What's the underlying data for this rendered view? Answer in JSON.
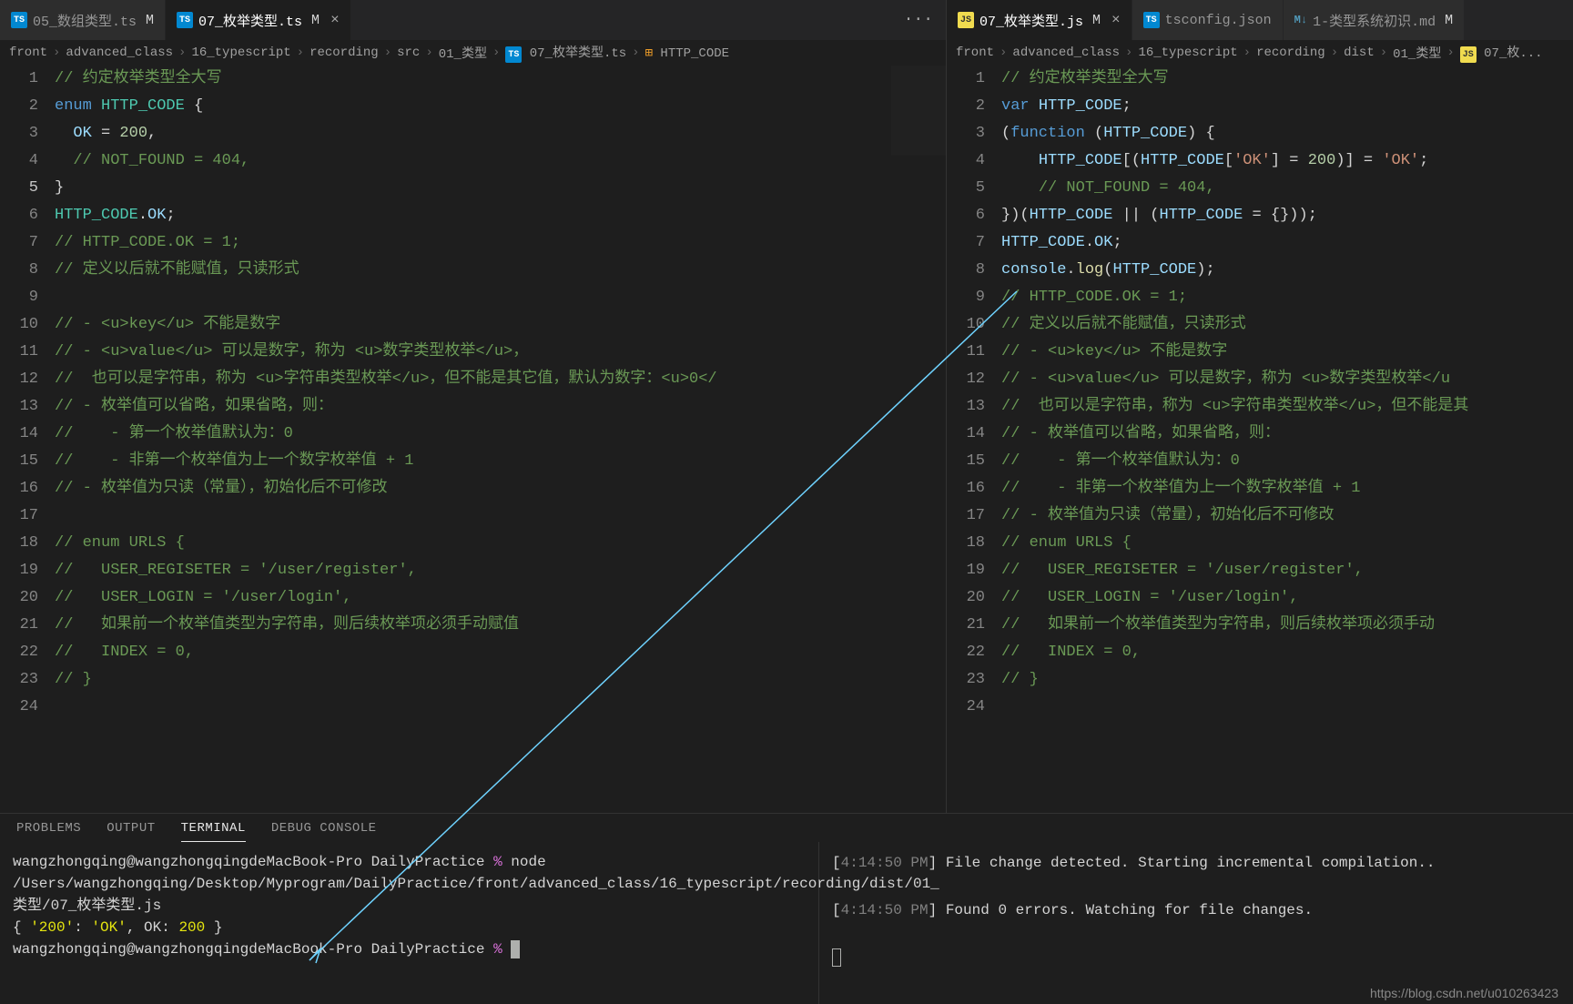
{
  "left": {
    "tabs": [
      {
        "icon": "ts",
        "label": "05_数组类型.ts",
        "status": "M",
        "active": false,
        "close": false
      },
      {
        "icon": "ts",
        "label": "07_枚举类型.ts",
        "status": "M",
        "active": true,
        "close": true
      }
    ],
    "overflow": "···",
    "breadcrumb": [
      "front",
      "advanced_class",
      "16_typescript",
      "recording",
      "src",
      "01_类型",
      "07_枚举类型.ts",
      "HTTP_CODE"
    ],
    "breadcrumb_icons": {
      "6": "ts",
      "7": "enum"
    },
    "lines": [
      {
        "n": 1,
        "mod": true,
        "html": "<span class='c-comment'>// 约定枚举类型全大写</span>"
      },
      {
        "n": 2,
        "mod": true,
        "html": "<span class='c-keyword'>enum</span> <span class='c-type'>HTTP_CODE</span> <span class='c-punct'>{</span>"
      },
      {
        "n": 3,
        "mod": true,
        "html": "  <span class='c-prop'>OK</span> <span class='c-punct'>=</span> <span class='c-number'>200</span><span class='c-punct'>,</span>"
      },
      {
        "n": 4,
        "mod": true,
        "html": "  <span class='c-comment'>// NOT_FOUND = 404,</span>"
      },
      {
        "n": 5,
        "mod": true,
        "html": "<span class='c-punct'>}</span>",
        "current": true
      },
      {
        "n": 6,
        "html": "<span class='c-type'>HTTP_CODE</span><span class='c-punct'>.</span><span class='c-prop'>OK</span><span class='c-punct'>;</span>"
      },
      {
        "n": 7,
        "html": "<span class='c-comment'>// HTTP_CODE.OK = 1;</span>"
      },
      {
        "n": 8,
        "html": "<span class='c-comment'>// 定义以后就不能赋值，只读形式</span>"
      },
      {
        "n": 9,
        "html": ""
      },
      {
        "n": 10,
        "html": "<span class='c-comment'>// - &lt;u&gt;key&lt;/u&gt; 不能是数字</span>"
      },
      {
        "n": 11,
        "html": "<span class='c-comment'>// - &lt;u&gt;value&lt;/u&gt; 可以是数字，称为 &lt;u&gt;数字类型枚举&lt;/u&gt;，</span>"
      },
      {
        "n": 12,
        "html": "<span class='c-comment'>//  也可以是字符串，称为 &lt;u&gt;字符串类型枚举&lt;/u&gt;，但不能是其它值，默认为数字：&lt;u&gt;0&lt;/</span>"
      },
      {
        "n": 13,
        "html": "<span class='c-comment'>// - 枚举值可以省略，如果省略，则：</span>"
      },
      {
        "n": 14,
        "html": "<span class='c-comment'>//    - 第一个枚举值默认为：0</span>"
      },
      {
        "n": 15,
        "html": "<span class='c-comment'>//    - 非第一个枚举值为上一个数字枚举值 + 1</span>"
      },
      {
        "n": 16,
        "html": "<span class='c-comment'>// - 枚举值为只读（常量），初始化后不可修改</span>"
      },
      {
        "n": 17,
        "html": ""
      },
      {
        "n": 18,
        "mod": true,
        "html": "<span class='c-comment'>// enum URLS {</span>"
      },
      {
        "n": 19,
        "mod": true,
        "html": "<span class='c-comment'>//   USER_REGISETER = '/user/register',</span>"
      },
      {
        "n": 20,
        "mod": true,
        "html": "<span class='c-comment'>//   USER_LOGIN = '/user/login',</span>"
      },
      {
        "n": 21,
        "mod": true,
        "html": "<span class='c-comment'>//   如果前一个枚举值类型为字符串，则后续枚举项必须手动赋值</span>"
      },
      {
        "n": 22,
        "mod": true,
        "html": "<span class='c-comment'>//   INDEX = 0,</span>"
      },
      {
        "n": 23,
        "mod": true,
        "html": "<span class='c-comment'>// }</span>"
      },
      {
        "n": 24,
        "html": ""
      }
    ]
  },
  "right": {
    "tabs": [
      {
        "icon": "js",
        "label": "07_枚举类型.js",
        "status": "M",
        "active": true,
        "close": true
      },
      {
        "icon": "ts-cfg",
        "label": "tsconfig.json",
        "status": "",
        "active": false,
        "close": false
      },
      {
        "icon": "md",
        "label": "1-类型系统初识.md",
        "status": "M",
        "active": false,
        "close": false
      }
    ],
    "breadcrumb": [
      "front",
      "advanced_class",
      "16_typescript",
      "recording",
      "dist",
      "01_类型",
      "07_枚..."
    ],
    "breadcrumb_icons": {
      "6": "js"
    },
    "lines": [
      {
        "n": 1,
        "mod": true,
        "html": "<span class='c-comment'>// 约定枚举类型全大写</span>"
      },
      {
        "n": 2,
        "mod": true,
        "html": "<span class='c-keyword'>var</span> <span class='c-prop'>HTTP_CODE</span><span class='c-punct'>;</span>"
      },
      {
        "n": 3,
        "mod": true,
        "fold": true,
        "html": "<span class='c-punct'>(</span><span class='c-keyword'>function</span> <span class='c-punct'>(</span><span class='c-prop'>HTTP_CODE</span><span class='c-punct'>) {</span>"
      },
      {
        "n": 4,
        "mod": true,
        "html": "    <span class='c-prop'>HTTP_CODE</span><span class='c-punct'>[(</span><span class='c-prop'>HTTP_CODE</span><span class='c-punct'>[</span><span class='c-string'>'OK'</span><span class='c-punct'>] = </span><span class='c-number'>200</span><span class='c-punct'>)] = </span><span class='c-string'>'OK'</span><span class='c-punct'>;</span>"
      },
      {
        "n": 5,
        "mod": true,
        "html": "    <span class='c-comment'>// NOT_FOUND = 404,</span>"
      },
      {
        "n": 6,
        "html": "<span class='c-punct'>})(</span><span class='c-prop'>HTTP_CODE</span> <span class='c-punct'>|| (</span><span class='c-prop'>HTTP_CODE</span> <span class='c-punct'>= {}));</span>"
      },
      {
        "n": 7,
        "html": "<span class='c-prop'>HTTP_CODE</span><span class='c-punct'>.</span><span class='c-prop'>OK</span><span class='c-punct'>;</span>"
      },
      {
        "n": 8,
        "mod": true,
        "html": "<span class='c-prop'>console</span><span class='c-punct'>.</span><span class='c-func'>log</span><span class='c-punct'>(</span><span class='c-prop'>HTTP_CODE</span><span class='c-punct'>);</span>"
      },
      {
        "n": 9,
        "fold": true,
        "html": "<span class='c-comment'>// HTTP_CODE.OK = 1;</span>"
      },
      {
        "n": 10,
        "html": "<span class='c-comment'>// 定义以后就不能赋值，只读形式</span>"
      },
      {
        "n": 11,
        "html": "<span class='c-comment'>// - &lt;u&gt;key&lt;/u&gt; 不能是数字</span>"
      },
      {
        "n": 12,
        "html": "<span class='c-comment'>// - &lt;u&gt;value&lt;/u&gt; 可以是数字，称为 &lt;u&gt;数字类型枚举&lt;/u</span>"
      },
      {
        "n": 13,
        "html": "<span class='c-comment'>//  也可以是字符串，称为 &lt;u&gt;字符串类型枚举&lt;/u&gt;，但不能是其</span>"
      },
      {
        "n": 14,
        "html": "<span class='c-comment'>// - 枚举值可以省略，如果省略，则：</span>"
      },
      {
        "n": 15,
        "html": "<span class='c-comment'>//    - 第一个枚举值默认为：0</span>"
      },
      {
        "n": 16,
        "html": "<span class='c-comment'>//    - 非第一个枚举值为上一个数字枚举值 + 1</span>"
      },
      {
        "n": 17,
        "html": "<span class='c-comment'>// - 枚举值为只读（常量），初始化后不可修改</span>"
      },
      {
        "n": 18,
        "mod": true,
        "html": "<span class='c-comment'>// enum URLS {</span>"
      },
      {
        "n": 19,
        "mod": true,
        "html": "<span class='c-comment'>//   USER_REGISETER = '/user/register',</span>"
      },
      {
        "n": 20,
        "mod": true,
        "html": "<span class='c-comment'>//   USER_LOGIN = '/user/login',</span>"
      },
      {
        "n": 21,
        "mod": true,
        "html": "<span class='c-comment'>//   如果前一个枚举值类型为字符串，则后续枚举项必须手动</span>"
      },
      {
        "n": 22,
        "mod": true,
        "html": "<span class='c-comment'>//   INDEX = 0,</span>"
      },
      {
        "n": 23,
        "mod": true,
        "html": "<span class='c-comment'>// }</span>"
      },
      {
        "n": 24,
        "html": ""
      }
    ]
  },
  "panel": {
    "tabs": [
      "PROBLEMS",
      "OUTPUT",
      "TERMINAL",
      "DEBUG CONSOLE"
    ],
    "active": 2,
    "terminal_left": {
      "prompt_user": "wangzhongqing@wangzhongqingdeMacBook-Pro",
      "prompt_dir": "DailyPractice",
      "cmd": "node /Users/wangzhongqing/Desktop/Myprogram/DailyPractice/front/advanced_class/16_typescript/recording/dist/01_类型/07_枚举类型.js",
      "output": "{ '200': 'OK', OK: 200 }",
      "output_hl_key": "200"
    },
    "terminal_right": {
      "lines": [
        {
          "time": "4:14:50 PM",
          "text": "File change detected. Starting incremental compilation.."
        },
        {
          "time": "4:14:50 PM",
          "text": "Found 0 errors. Watching for file changes."
        }
      ]
    }
  },
  "watermark": "https://blog.csdn.net/u010263423"
}
